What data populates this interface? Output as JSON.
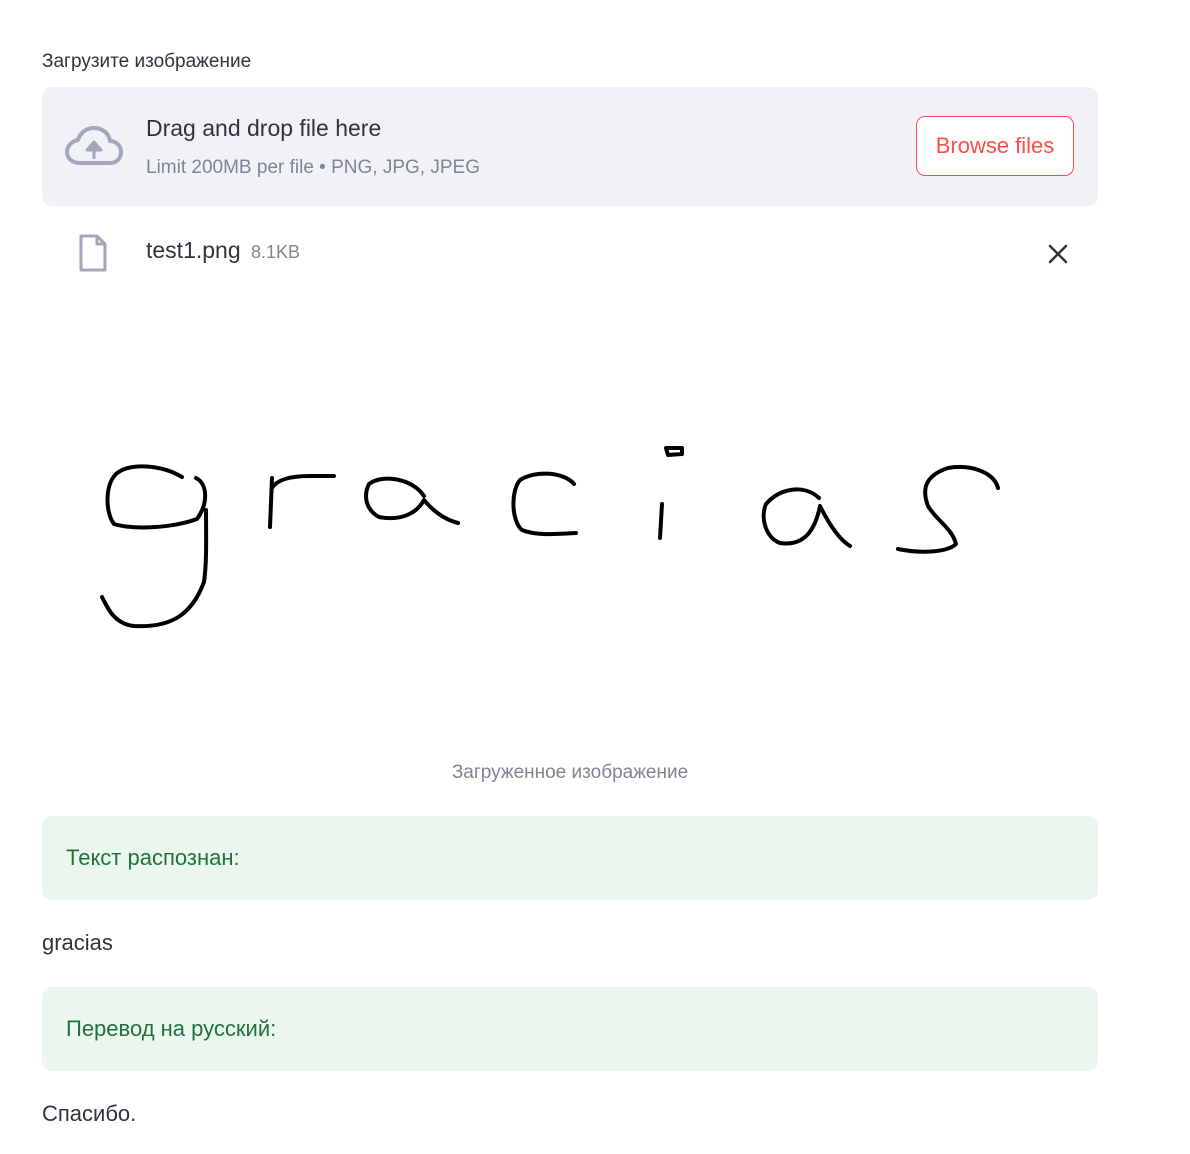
{
  "uploader": {
    "label": "Загрузите изображение",
    "dropzone_title": "Drag and drop file here",
    "dropzone_limit": "Limit 200MB per file • PNG, JPG, JPEG",
    "browse_label": "Browse files",
    "icons": {
      "upload": "cloud-upload-icon",
      "file": "file-icon",
      "remove": "close-icon"
    },
    "colors": {
      "accent": "#ff4b4b",
      "dropzone_bg": "#f0f2f6",
      "icon_gray": "#a3a8b8"
    }
  },
  "uploaded_file": {
    "name": "test1.png",
    "size": "8.1KB"
  },
  "image": {
    "handwritten_text": "gracias",
    "caption": "Загруженное изображение"
  },
  "recognition": {
    "alert_label": "Текст распознан:",
    "result": "gracias"
  },
  "translation": {
    "alert_label": "Перевод на русский:",
    "result": "Спасибо."
  },
  "colors": {
    "success_bg": "#ebf7ee",
    "success_text": "#21723b",
    "text": "#31333f",
    "muted": "#808495"
  }
}
